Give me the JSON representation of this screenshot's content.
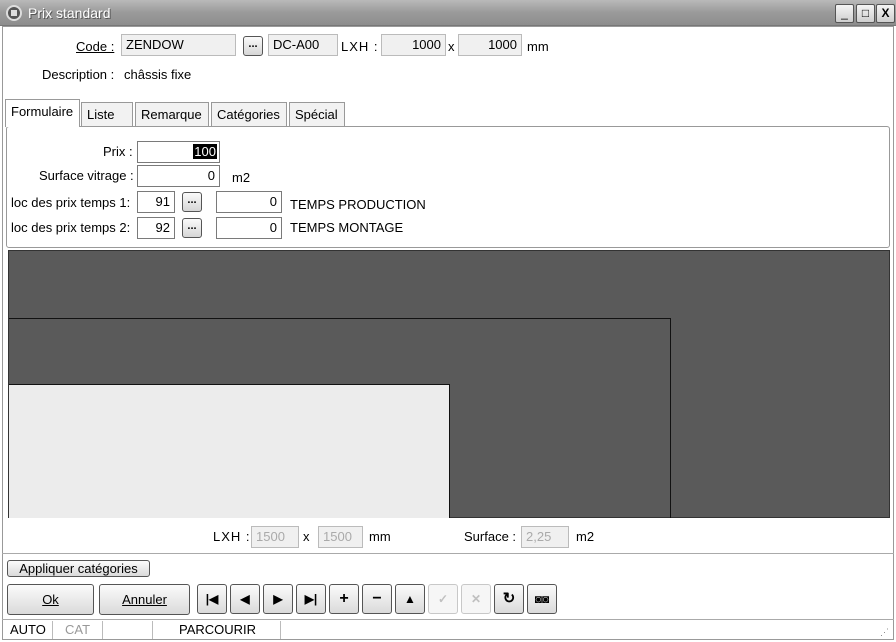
{
  "window": {
    "title": "Prix standard",
    "minimize": "_",
    "maximize": "□",
    "close": "X"
  },
  "header": {
    "code_label": "Code :",
    "code_value": "ZENDOW",
    "code_button": "...",
    "ref_value": "DC-A00",
    "lxh_label": "LXH :",
    "width_value": "1000",
    "x_sep": "x",
    "height_value": "1000",
    "unit": "mm",
    "description_label": "Description :",
    "description_value": "châssis fixe"
  },
  "tabs": [
    {
      "label": "Formulaire",
      "active": true
    },
    {
      "label": "Liste"
    },
    {
      "label": "Remarque"
    },
    {
      "label": "Catégories"
    },
    {
      "label": "Spécial"
    }
  ],
  "form": {
    "prix_label": "Prix :",
    "prix_value": "100",
    "surface_label": "Surface vitrage :",
    "surface_value": "0",
    "surface_unit": "m2",
    "loc1_label": "loc des prix temps 1:",
    "loc1_value": "91",
    "loc1_button": "...",
    "loc1_time": "0",
    "loc1_desc": "TEMPS PRODUCTION",
    "loc2_label": "loc des prix temps 2:",
    "loc2_value": "92",
    "loc2_button": "...",
    "loc2_time": "0",
    "loc2_desc": "TEMPS MONTAGE"
  },
  "footer_dims": {
    "lxh_label": "LXH :",
    "width": "1500",
    "x_sep": "x",
    "height": "1500",
    "unit": "mm",
    "surface_label": "Surface :",
    "surface_value": "2,25",
    "surface_unit": "m2"
  },
  "buttons": {
    "apply_categories": "Appliquer catégories",
    "ok": "Ok",
    "cancel": "Annuler"
  },
  "nav_icons": [
    "first-icon",
    "prev-icon",
    "next-icon",
    "last-icon",
    "add-icon",
    "remove-icon",
    "up-icon",
    "check-icon",
    "cancel-x-icon",
    "refresh-icon",
    "binoculars-icon"
  ],
  "status": {
    "mode1": "AUTO",
    "mode2": "CAT",
    "mode3": "PARCOURIR"
  },
  "colors": {
    "canvas": "#5a5a5a",
    "glass": "#ececec",
    "title_bar": "#a0a0a0"
  }
}
